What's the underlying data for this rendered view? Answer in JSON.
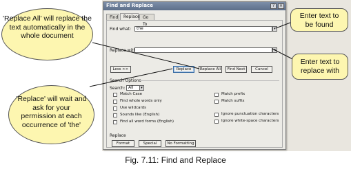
{
  "dialog": {
    "title": "Find and Replace",
    "help_glyph": "?",
    "close_glyph": "×",
    "tabs": [
      "Find",
      "Replace",
      "Go To"
    ],
    "find_label": "Find what:",
    "find_value": "the",
    "replace_label": "Replace with:",
    "replace_value": "",
    "dropdown_glyph": "▾",
    "buttons": {
      "less": "Less >>",
      "replace": "Replace",
      "replace_all": "Replace All",
      "find_next": "Find Next",
      "cancel": "Cancel"
    },
    "search_options_label": "Search Options",
    "search_label": "Search:",
    "search_value": "All",
    "options_left": [
      "Match Case",
      "Find whole words only",
      "Use wildcards",
      "Sounds like (English)",
      "Find all word forms (English)"
    ],
    "options_right": [
      "Match prefix",
      "Match suffix",
      "Ignore punctuation characters",
      "Ignore white-space characters"
    ],
    "replace_section_label": "Replace",
    "bottom_buttons": [
      "Format",
      "Special",
      "No Formatting"
    ]
  },
  "callouts": {
    "replace_all": "'Replace All' will replace the text automatically in the whole document",
    "replace": "'Replace' will wait and ask for your permission at each occurrence of 'the'",
    "find": "Enter text to be found",
    "replace_with": "Enter text to replace with"
  },
  "caption": "Fig. 7.11: Find and Replace",
  "colors": {
    "bubble": "#fdf6b0",
    "titlebar": "#5d6f8a"
  }
}
